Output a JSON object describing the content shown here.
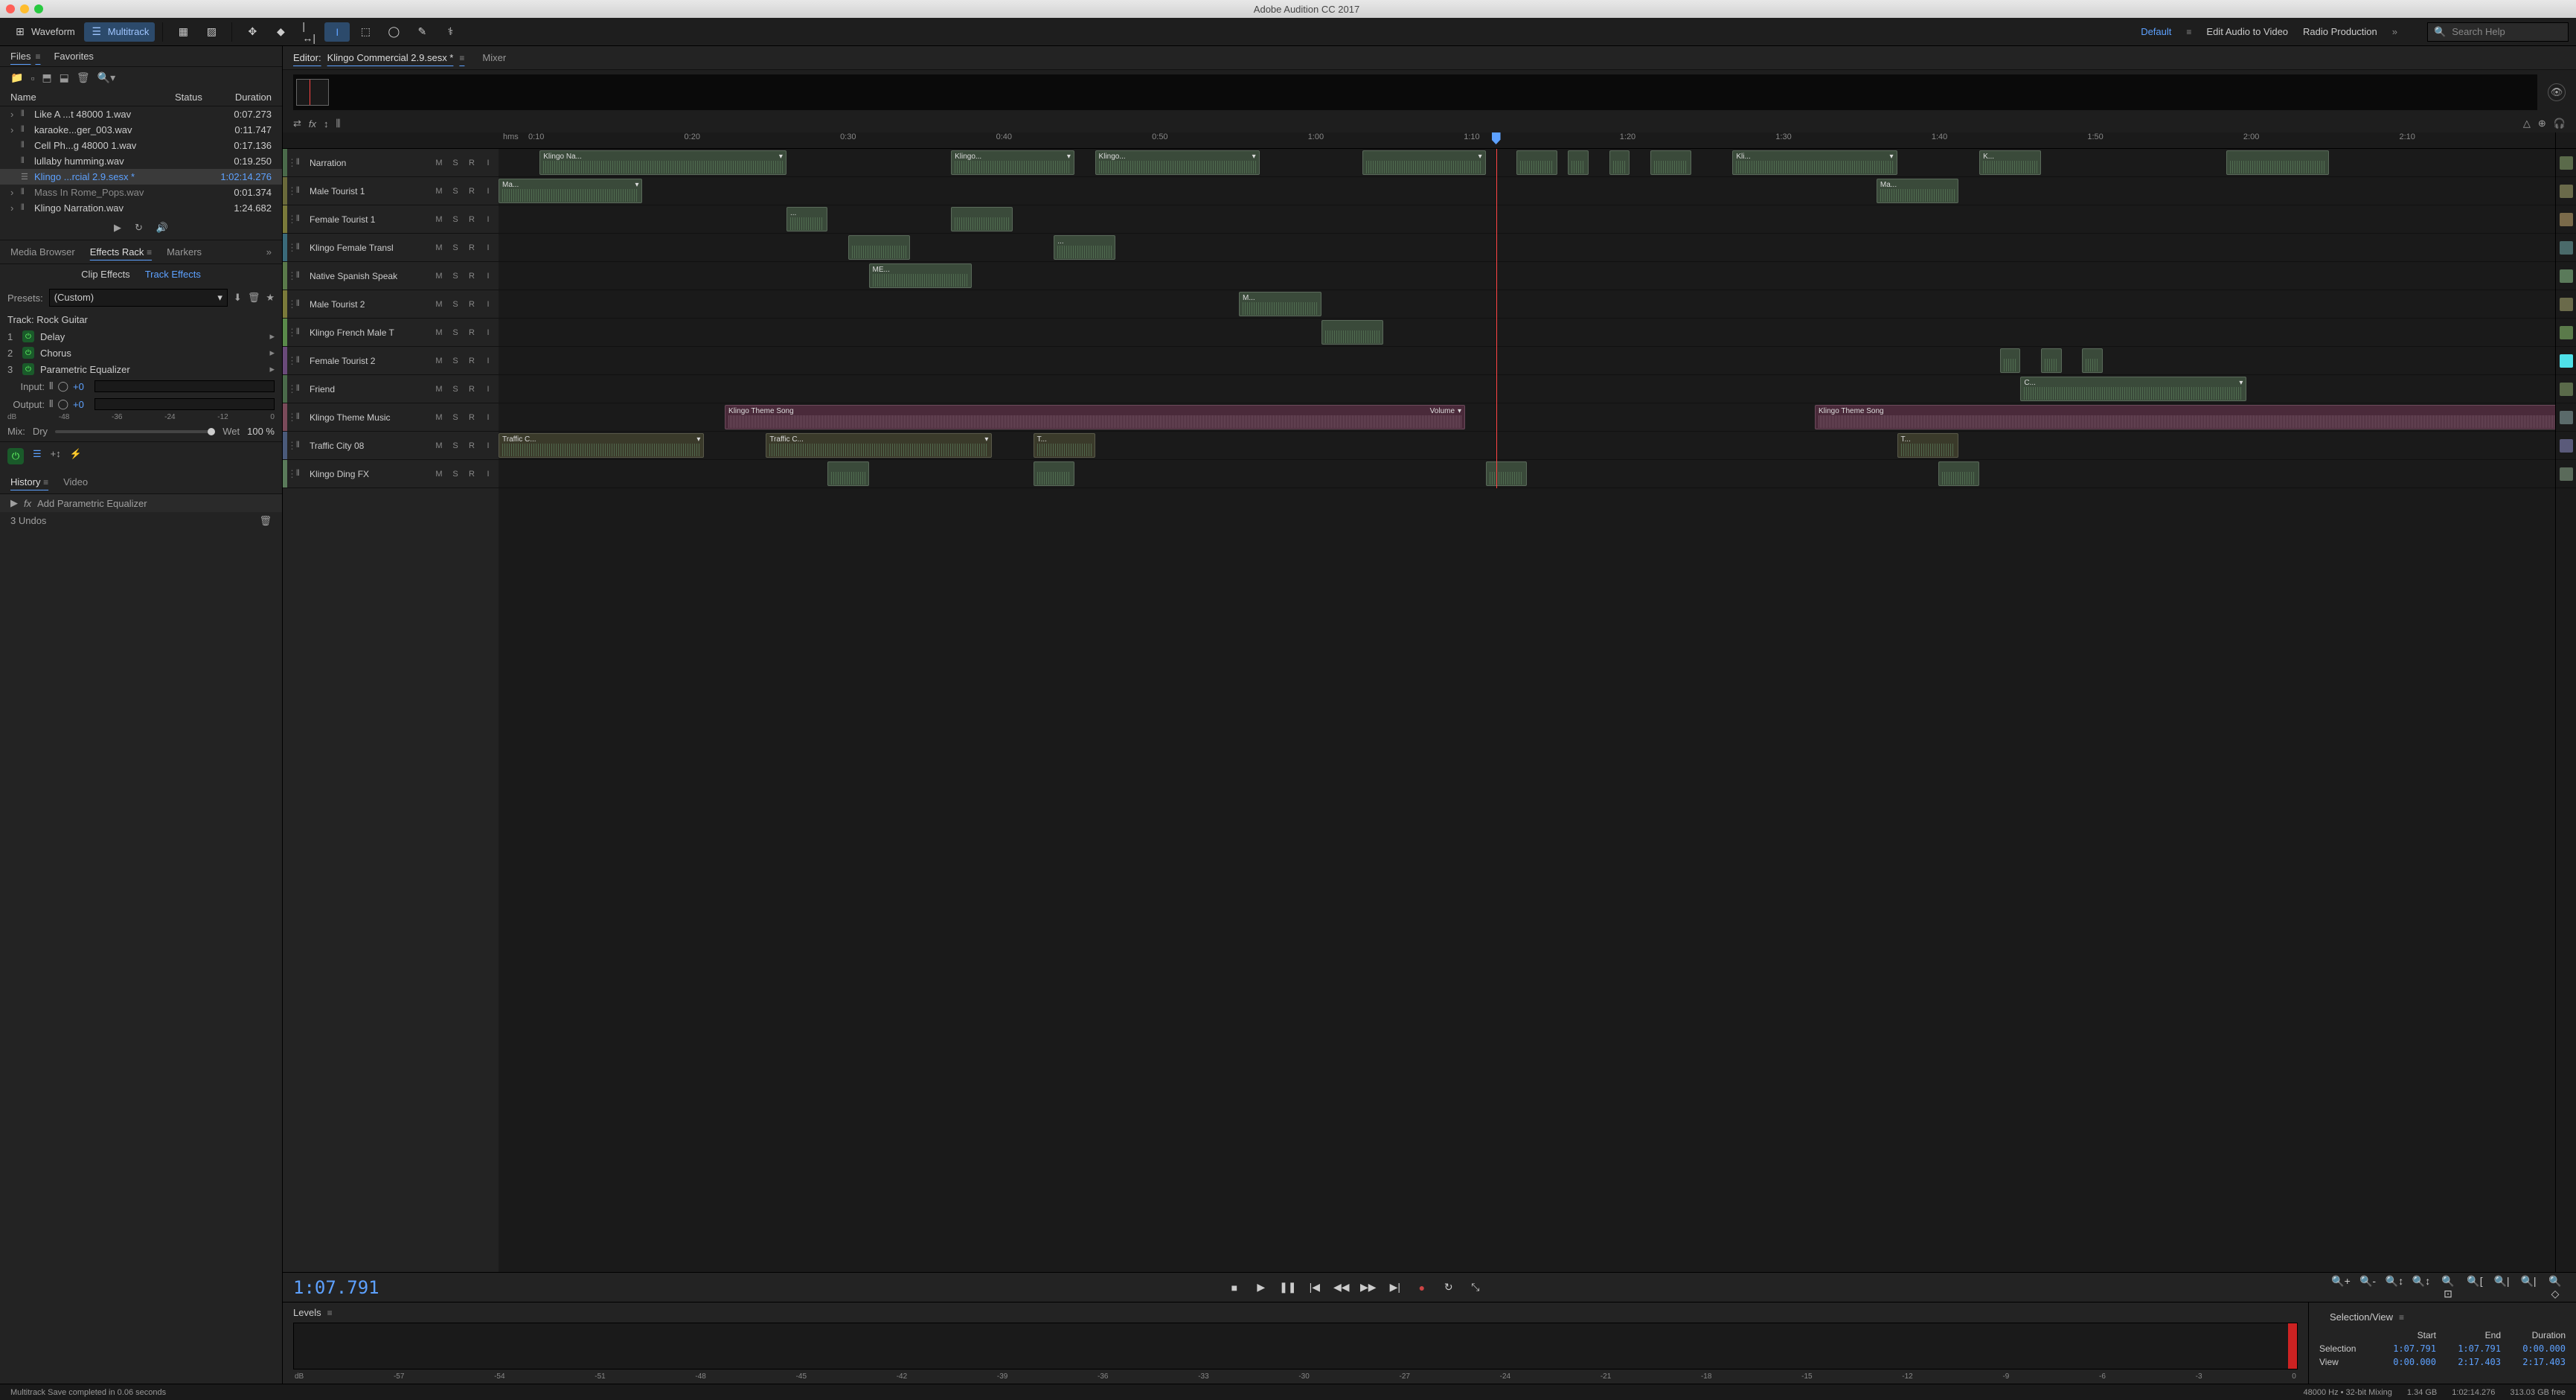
{
  "app_title": "Adobe Audition CC 2017",
  "toolbar": {
    "waveform": "Waveform",
    "multitrack": "Multitrack"
  },
  "workspaces": {
    "default": "Default",
    "edit_audio": "Edit Audio to Video",
    "radio": "Radio Production"
  },
  "search_placeholder": "Search Help",
  "files_panel": {
    "tab_files": "Files",
    "tab_favorites": "Favorites",
    "col_name": "Name",
    "col_status": "Status",
    "col_duration": "Duration",
    "items": [
      {
        "name": "Like A ...t 48000 1.wav",
        "duration": "0:07.273",
        "exp": true
      },
      {
        "name": "karaoke...ger_003.wav",
        "duration": "0:11.747",
        "exp": true
      },
      {
        "name": "Cell Ph...g 48000 1.wav",
        "duration": "0:17.136",
        "exp": false
      },
      {
        "name": "lullaby humming.wav",
        "duration": "0:19.250",
        "exp": false
      },
      {
        "name": "Klingo ...rcial 2.9.sesx *",
        "duration": "1:02:14.276",
        "exp": false,
        "selected": true,
        "session": true
      },
      {
        "name": "Mass In Rome_Pops.wav",
        "duration": "0:01.374",
        "exp": true,
        "dim": true
      },
      {
        "name": "Klingo Narration.wav",
        "duration": "1:24.682",
        "exp": true
      }
    ]
  },
  "fx_panel": {
    "media_browser": "Media Browser",
    "effects_rack": "Effects Rack",
    "markers": "Markers",
    "clip_effects": "Clip Effects",
    "track_effects": "Track Effects",
    "presets_label": "Presets:",
    "preset_value": "(Custom)",
    "track_label": "Track: Rock Guitar",
    "slots": [
      {
        "n": "1",
        "name": "Delay"
      },
      {
        "n": "2",
        "name": "Chorus"
      },
      {
        "n": "3",
        "name": "Parametric Equalizer"
      }
    ],
    "input_label": "Input:",
    "input_val": "+0",
    "output_label": "Output:",
    "output_val": "+0",
    "db_marks": [
      "dB",
      "-48",
      "-36",
      "-24",
      "-12",
      "0"
    ],
    "mix_label": "Mix:",
    "dry": "Dry",
    "wet": "Wet",
    "mix_pct": "100 %"
  },
  "history_panel": {
    "history": "History",
    "video": "Video",
    "entry": "Add Parametric Equalizer",
    "undos": "3 Undos"
  },
  "editor": {
    "tab_editor_prefix": "Editor:",
    "tab_editor_file": "Klingo Commercial 2.9.sesx *",
    "tab_mixer": "Mixer",
    "ruler_label": "hms",
    "ruler_ticks": [
      "0:10",
      "0:20",
      "0:30",
      "0:40",
      "0:50",
      "1:00",
      "1:10",
      "1:20",
      "1:30",
      "1:40",
      "1:50",
      "2:00",
      "2:10"
    ],
    "tracks": [
      {
        "name": "Narration",
        "color": "#4a6a4a",
        "clips": [
          {
            "l": 2,
            "w": 12,
            "t": "Klingo Na..."
          },
          {
            "l": 22,
            "w": 6,
            "t": "Klingo..."
          },
          {
            "l": 29,
            "w": 8,
            "t": "Klingo..."
          },
          {
            "l": 42,
            "w": 6,
            "t": ""
          },
          {
            "l": 49.5,
            "w": 2,
            "t": ""
          },
          {
            "l": 52,
            "w": 1,
            "t": ""
          },
          {
            "l": 54,
            "w": 1,
            "t": ""
          },
          {
            "l": 56,
            "w": 2,
            "t": ""
          },
          {
            "l": 60,
            "w": 8,
            "t": "Kli..."
          },
          {
            "l": 72,
            "w": 3,
            "t": "K..."
          },
          {
            "l": 84,
            "w": 5,
            "t": ""
          }
        ]
      },
      {
        "name": "Male Tourist 1",
        "color": "#6a6a3a",
        "clips": [
          {
            "l": 0,
            "w": 7,
            "t": "Ma..."
          },
          {
            "l": 67,
            "w": 4,
            "t": "Ma..."
          }
        ]
      },
      {
        "name": "Female Tourist 1",
        "color": "#7a7a3a",
        "clips": [
          {
            "l": 14,
            "w": 2,
            "t": "..."
          },
          {
            "l": 22,
            "w": 3,
            "t": ""
          }
        ]
      },
      {
        "name": "Klingo Female Transl",
        "color": "#3a6a7a",
        "clips": [
          {
            "l": 17,
            "w": 3,
            "t": ""
          },
          {
            "l": 27,
            "w": 3,
            "t": "..."
          }
        ]
      },
      {
        "name": "Native Spanish Speak",
        "color": "#5a7a4a",
        "clips": [
          {
            "l": 18,
            "w": 5,
            "t": "ME..."
          }
        ]
      },
      {
        "name": "Male Tourist 2",
        "color": "#7a7a3a",
        "clips": [
          {
            "l": 36,
            "w": 4,
            "t": "M..."
          }
        ]
      },
      {
        "name": "Klingo French Male T",
        "color": "#5a8a4a",
        "clips": [
          {
            "l": 40,
            "w": 3,
            "t": ""
          }
        ]
      },
      {
        "name": "Female Tourist 2",
        "color": "#6a4a7a",
        "clips": [
          {
            "l": 73,
            "w": 1,
            "t": ""
          },
          {
            "l": 75,
            "w": 1,
            "t": ""
          },
          {
            "l": 77,
            "w": 1,
            "t": ""
          }
        ]
      },
      {
        "name": "Friend",
        "color": "#4a6a4a",
        "clips": [
          {
            "l": 74,
            "w": 11,
            "t": "C...",
            "pink": false
          }
        ]
      },
      {
        "name": "Klingo Theme Music",
        "color": "#7a4a5a",
        "clips": [
          {
            "l": 11,
            "w": 36,
            "t": "Klingo Theme Song",
            "extra": "Volume",
            "pink": true
          },
          {
            "l": 64,
            "w": 38,
            "t": "Klingo Theme Song",
            "pink": true
          }
        ]
      },
      {
        "name": "Traffic City 08",
        "color": "#4a5a7a",
        "clips": [
          {
            "l": 0,
            "w": 10,
            "t": "Traffic C...",
            "olive": true
          },
          {
            "l": 13,
            "w": 11,
            "t": "Traffic C...",
            "olive": true
          },
          {
            "l": 26,
            "w": 3,
            "t": "T...",
            "olive": true
          },
          {
            "l": 68,
            "w": 3,
            "t": "T...",
            "olive": true
          }
        ]
      },
      {
        "name": "Klingo Ding FX",
        "color": "#5a7a5a",
        "clips": [
          {
            "l": 16,
            "w": 2,
            "t": ""
          },
          {
            "l": 26,
            "w": 2,
            "t": ""
          },
          {
            "l": 48,
            "w": 2,
            "t": ""
          },
          {
            "l": 70,
            "w": 2,
            "t": ""
          }
        ]
      }
    ],
    "meter_colors": [
      "#5a6a4a",
      "#6a6a4a",
      "#7a6a4a",
      "#4a6a6a",
      "#5a7a5a",
      "#6a6a4a",
      "#5a7a4a",
      "#4fe0e8",
      "#5a6a4a",
      "#5a6a6a",
      "#5a5a7a",
      "#5a6a5a"
    ],
    "playhead_pct": 48.5
  },
  "transport": {
    "timecode": "1:07.791"
  },
  "levels": {
    "title": "Levels",
    "scale": [
      "dB",
      "-57",
      "-54",
      "-51",
      "-48",
      "-45",
      "-42",
      "-39",
      "-36",
      "-33",
      "-30",
      "-27",
      "-24",
      "-21",
      "-18",
      "-15",
      "-12",
      "-9",
      "-6",
      "-3",
      "0"
    ]
  },
  "selview": {
    "title": "Selection/View",
    "start": "Start",
    "end": "End",
    "duration": "Duration",
    "sel_label": "Selection",
    "sel": {
      "start": "1:07.791",
      "end": "1:07.791",
      "dur": "0:00.000"
    },
    "view_label": "View",
    "view": {
      "start": "0:00.000",
      "end": "2:17.403",
      "dur": "2:17.403"
    }
  },
  "status": {
    "msg": "Multitrack Save completed in 0.06 seconds",
    "sample": "48000 Hz • 32-bit Mixing",
    "mem": "1.34 GB",
    "dur": "1:02:14.276",
    "disk": "313.03 GB free"
  }
}
